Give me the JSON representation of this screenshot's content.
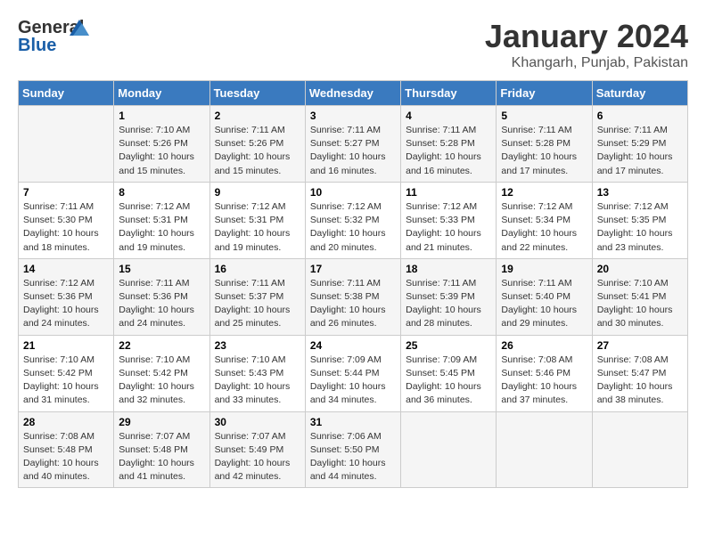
{
  "header": {
    "logo_general": "General",
    "logo_blue": "Blue",
    "month_title": "January 2024",
    "location": "Khangarh, Punjab, Pakistan"
  },
  "days_of_week": [
    "Sunday",
    "Monday",
    "Tuesday",
    "Wednesday",
    "Thursday",
    "Friday",
    "Saturday"
  ],
  "weeks": [
    [
      {
        "day": "",
        "info": ""
      },
      {
        "day": "1",
        "info": "Sunrise: 7:10 AM\nSunset: 5:26 PM\nDaylight: 10 hours\nand 15 minutes."
      },
      {
        "day": "2",
        "info": "Sunrise: 7:11 AM\nSunset: 5:26 PM\nDaylight: 10 hours\nand 15 minutes."
      },
      {
        "day": "3",
        "info": "Sunrise: 7:11 AM\nSunset: 5:27 PM\nDaylight: 10 hours\nand 16 minutes."
      },
      {
        "day": "4",
        "info": "Sunrise: 7:11 AM\nSunset: 5:28 PM\nDaylight: 10 hours\nand 16 minutes."
      },
      {
        "day": "5",
        "info": "Sunrise: 7:11 AM\nSunset: 5:28 PM\nDaylight: 10 hours\nand 17 minutes."
      },
      {
        "day": "6",
        "info": "Sunrise: 7:11 AM\nSunset: 5:29 PM\nDaylight: 10 hours\nand 17 minutes."
      }
    ],
    [
      {
        "day": "7",
        "info": "Sunrise: 7:11 AM\nSunset: 5:30 PM\nDaylight: 10 hours\nand 18 minutes."
      },
      {
        "day": "8",
        "info": "Sunrise: 7:12 AM\nSunset: 5:31 PM\nDaylight: 10 hours\nand 19 minutes."
      },
      {
        "day": "9",
        "info": "Sunrise: 7:12 AM\nSunset: 5:31 PM\nDaylight: 10 hours\nand 19 minutes."
      },
      {
        "day": "10",
        "info": "Sunrise: 7:12 AM\nSunset: 5:32 PM\nDaylight: 10 hours\nand 20 minutes."
      },
      {
        "day": "11",
        "info": "Sunrise: 7:12 AM\nSunset: 5:33 PM\nDaylight: 10 hours\nand 21 minutes."
      },
      {
        "day": "12",
        "info": "Sunrise: 7:12 AM\nSunset: 5:34 PM\nDaylight: 10 hours\nand 22 minutes."
      },
      {
        "day": "13",
        "info": "Sunrise: 7:12 AM\nSunset: 5:35 PM\nDaylight: 10 hours\nand 23 minutes."
      }
    ],
    [
      {
        "day": "14",
        "info": "Sunrise: 7:12 AM\nSunset: 5:36 PM\nDaylight: 10 hours\nand 24 minutes."
      },
      {
        "day": "15",
        "info": "Sunrise: 7:11 AM\nSunset: 5:36 PM\nDaylight: 10 hours\nand 24 minutes."
      },
      {
        "day": "16",
        "info": "Sunrise: 7:11 AM\nSunset: 5:37 PM\nDaylight: 10 hours\nand 25 minutes."
      },
      {
        "day": "17",
        "info": "Sunrise: 7:11 AM\nSunset: 5:38 PM\nDaylight: 10 hours\nand 26 minutes."
      },
      {
        "day": "18",
        "info": "Sunrise: 7:11 AM\nSunset: 5:39 PM\nDaylight: 10 hours\nand 28 minutes."
      },
      {
        "day": "19",
        "info": "Sunrise: 7:11 AM\nSunset: 5:40 PM\nDaylight: 10 hours\nand 29 minutes."
      },
      {
        "day": "20",
        "info": "Sunrise: 7:10 AM\nSunset: 5:41 PM\nDaylight: 10 hours\nand 30 minutes."
      }
    ],
    [
      {
        "day": "21",
        "info": "Sunrise: 7:10 AM\nSunset: 5:42 PM\nDaylight: 10 hours\nand 31 minutes."
      },
      {
        "day": "22",
        "info": "Sunrise: 7:10 AM\nSunset: 5:42 PM\nDaylight: 10 hours\nand 32 minutes."
      },
      {
        "day": "23",
        "info": "Sunrise: 7:10 AM\nSunset: 5:43 PM\nDaylight: 10 hours\nand 33 minutes."
      },
      {
        "day": "24",
        "info": "Sunrise: 7:09 AM\nSunset: 5:44 PM\nDaylight: 10 hours\nand 34 minutes."
      },
      {
        "day": "25",
        "info": "Sunrise: 7:09 AM\nSunset: 5:45 PM\nDaylight: 10 hours\nand 36 minutes."
      },
      {
        "day": "26",
        "info": "Sunrise: 7:08 AM\nSunset: 5:46 PM\nDaylight: 10 hours\nand 37 minutes."
      },
      {
        "day": "27",
        "info": "Sunrise: 7:08 AM\nSunset: 5:47 PM\nDaylight: 10 hours\nand 38 minutes."
      }
    ],
    [
      {
        "day": "28",
        "info": "Sunrise: 7:08 AM\nSunset: 5:48 PM\nDaylight: 10 hours\nand 40 minutes."
      },
      {
        "day": "29",
        "info": "Sunrise: 7:07 AM\nSunset: 5:48 PM\nDaylight: 10 hours\nand 41 minutes."
      },
      {
        "day": "30",
        "info": "Sunrise: 7:07 AM\nSunset: 5:49 PM\nDaylight: 10 hours\nand 42 minutes."
      },
      {
        "day": "31",
        "info": "Sunrise: 7:06 AM\nSunset: 5:50 PM\nDaylight: 10 hours\nand 44 minutes."
      },
      {
        "day": "",
        "info": ""
      },
      {
        "day": "",
        "info": ""
      },
      {
        "day": "",
        "info": ""
      }
    ]
  ]
}
